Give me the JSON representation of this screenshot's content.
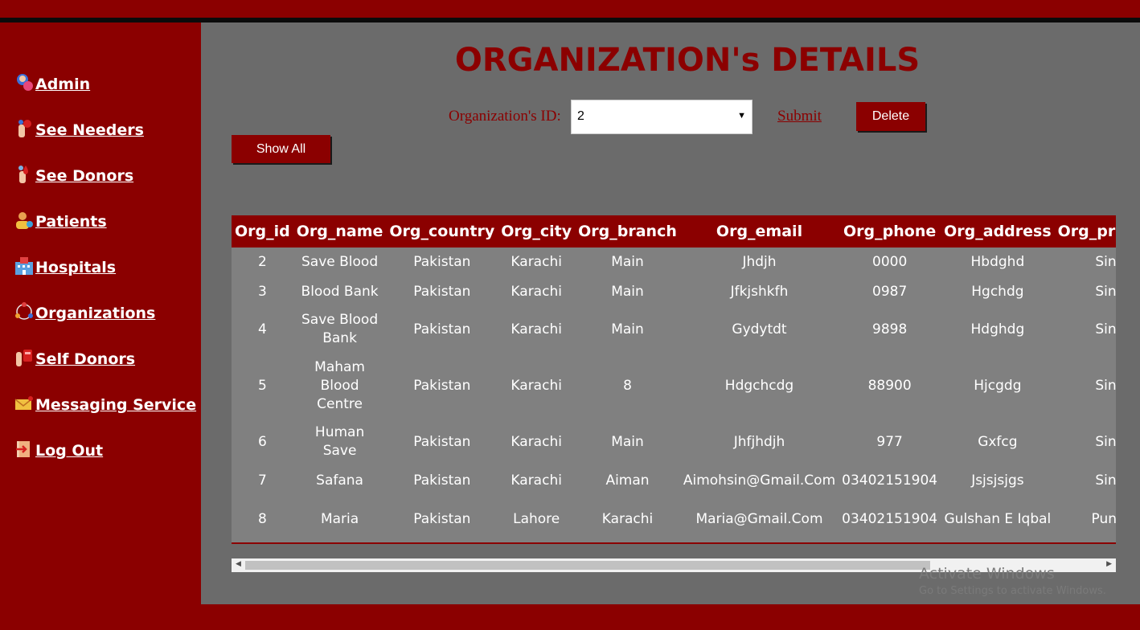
{
  "sidebar": {
    "items": [
      {
        "label": " Admin",
        "icon": "admin-icon"
      },
      {
        "label": " See Needers",
        "icon": "needers-icon"
      },
      {
        "label": " See Donors",
        "icon": "donors-icon"
      },
      {
        "label": " Patients",
        "icon": "patients-icon"
      },
      {
        "label": " Hospitals",
        "icon": "hospital-icon"
      },
      {
        "label": " Organizations",
        "icon": "organization-icon"
      },
      {
        "label": " Self Donors",
        "icon": "blood-bag-icon"
      },
      {
        "label": " Messaging Service",
        "icon": "mail-icon"
      },
      {
        "label": " Log Out",
        "icon": "logout-icon"
      }
    ]
  },
  "page": {
    "title": "ORGANIZATION's DETAILS",
    "id_label": "Organization's ID:",
    "selected_id": "2",
    "submit_label": "Submit",
    "delete_label": "Delete",
    "show_all_label": "Show All"
  },
  "table": {
    "headers": [
      "Org_id",
      "Org_name",
      "Org_country",
      "Org_city",
      "Org_branch",
      "Org_email",
      "Org_phone",
      "Org_address",
      "Org_province"
    ],
    "rows": [
      [
        "2",
        "Save Blood",
        "Pakistan",
        "Karachi",
        "Main",
        "Jhdjh",
        "0000",
        "Hbdghd",
        "Sindh"
      ],
      [
        "3",
        "Blood Bank",
        "Pakistan",
        "Karachi",
        "Main",
        "Jfkjshkfh",
        "0987",
        "Hgchdg",
        "Sindh"
      ],
      [
        "4",
        "Save Blood Bank",
        "Pakistan",
        "Karachi",
        "Main",
        "Gydytdt",
        "9898",
        "Hdghdg",
        "Sindh"
      ],
      [
        "5",
        "Maham Blood Centre",
        "Pakistan",
        "Karachi",
        "8",
        "Hdgchcdg",
        "88900",
        "Hjcgdg",
        "Sindh"
      ],
      [
        "6",
        "Human Save",
        "Pakistan",
        "Karachi",
        "Main",
        "Jhfjhdjh",
        "977",
        "Gxfcg",
        "Sindh"
      ],
      [
        "7",
        "Safana",
        "Pakistan",
        "Karachi",
        "Aiman",
        "Aimohsin@Gmail.Com",
        "03402151904",
        "Jsjsjsjgs",
        "Sindh"
      ],
      [
        "8",
        "Maria",
        "Pakistan",
        "Lahore",
        "Karachi",
        "Maria@Gmail.Com",
        "03402151904",
        "Gulshan E Iqbal",
        "Punjab"
      ]
    ]
  },
  "watermark": {
    "line1": "Activate Windows",
    "line2": "Go to Settings to activate Windows."
  },
  "colors": {
    "brand": "#8b0000",
    "content_bg": "#6b6b6b",
    "table_bg": "#808080"
  }
}
